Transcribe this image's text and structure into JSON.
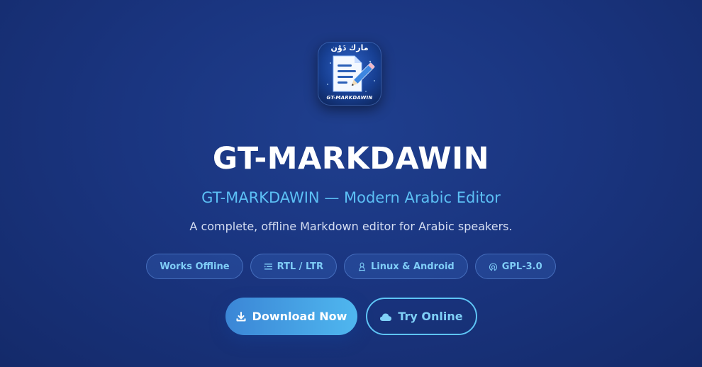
{
  "logo": {
    "icon": "document-pencil-icon",
    "arabic_text": "مارك دَوْن",
    "latin_text": "GT-MARKDAWIN"
  },
  "hero": {
    "title": "GT-MARKDAWIN",
    "subtitle": "GT-MARKDAWIN — Modern Arabic Editor",
    "tagline": "A complete, offline Markdown editor for Arabic speakers."
  },
  "badges": [
    {
      "label": "Works Offline",
      "icon": ""
    },
    {
      "label": "RTL / LTR",
      "icon": "align-icon"
    },
    {
      "label": "Linux & Android",
      "icon": "linux-icon"
    },
    {
      "label": "GPL-3.0",
      "icon": "open-source-icon"
    }
  ],
  "buttons": {
    "download": {
      "label": "Download Now",
      "icon": "download-icon"
    },
    "online": {
      "label": "Try Online",
      "icon": "cloud-icon"
    }
  },
  "colors": {
    "background": "#1a3580",
    "accent": "#5cc0f5",
    "badge_text": "#7fcdf7",
    "title": "#ffffff"
  }
}
